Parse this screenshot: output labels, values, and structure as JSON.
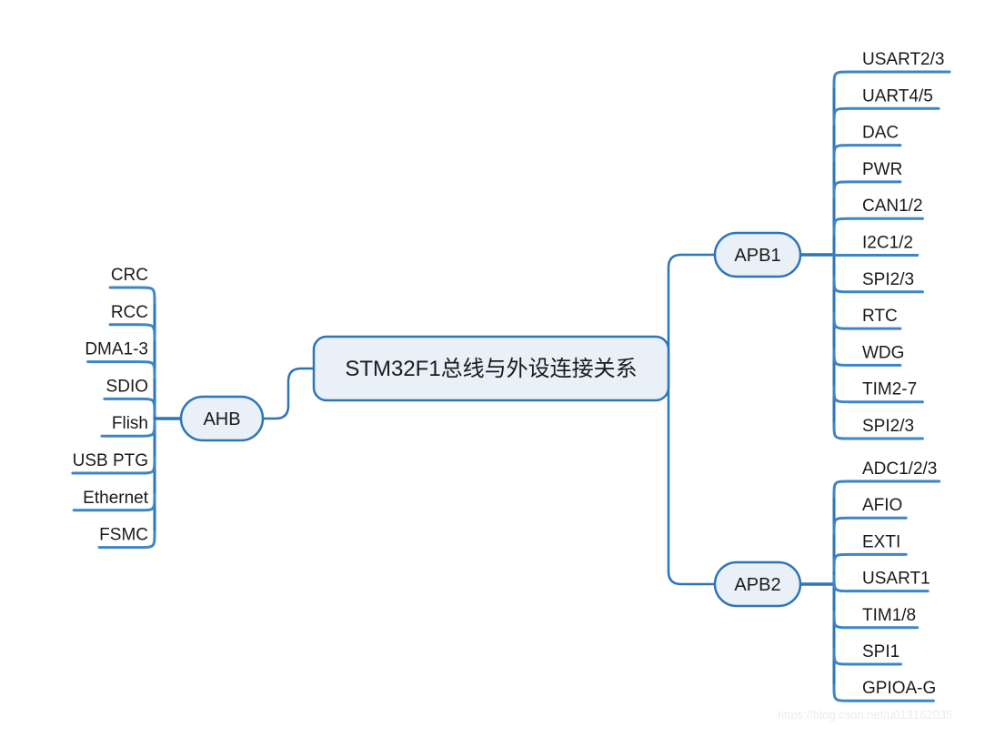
{
  "diagram": {
    "type": "mind-map",
    "title": "STM32F1总线与外设连接关系",
    "center": {
      "label": "STM32F1总线与外设连接关系"
    },
    "branches": [
      {
        "id": "ahb",
        "hub_label": "AHB",
        "side": "left",
        "items": [
          {
            "label": "CRC"
          },
          {
            "label": "RCC"
          },
          {
            "label": "DMA1-3"
          },
          {
            "label": "SDIO"
          },
          {
            "label": "Flish"
          },
          {
            "label": "USB PTG"
          },
          {
            "label": "Ethernet"
          },
          {
            "label": "FSMC"
          }
        ]
      },
      {
        "id": "apb1",
        "hub_label": "APB1",
        "side": "right",
        "items": [
          {
            "label": "USART2/3"
          },
          {
            "label": "UART4/5"
          },
          {
            "label": "DAC"
          },
          {
            "label": "PWR"
          },
          {
            "label": "CAN1/2"
          },
          {
            "label": "I2C1/2"
          },
          {
            "label": "SPI2/3"
          },
          {
            "label": "RTC"
          },
          {
            "label": "WDG"
          },
          {
            "label": "TIM2-7"
          },
          {
            "label": "SPI2/3"
          }
        ]
      },
      {
        "id": "apb2",
        "hub_label": "APB2",
        "side": "right",
        "items": [
          {
            "label": "ADC1/2/3"
          },
          {
            "label": "AFIO"
          },
          {
            "label": "EXTI"
          },
          {
            "label": "USART1"
          },
          {
            "label": "TIM1/8"
          },
          {
            "label": "SPI1"
          },
          {
            "label": "GPIOA-G"
          }
        ]
      }
    ]
  },
  "watermark": {
    "text": "https://blog.csdn.net/u013162035"
  },
  "colors": {
    "line": "#2e75b6",
    "line_light": "#3d85c6",
    "node_fill": "#eaf0f8",
    "node_stroke": "#2e75b6",
    "text": "#1a1a1a",
    "watermark": "#ececec",
    "background": "#ffffff"
  }
}
